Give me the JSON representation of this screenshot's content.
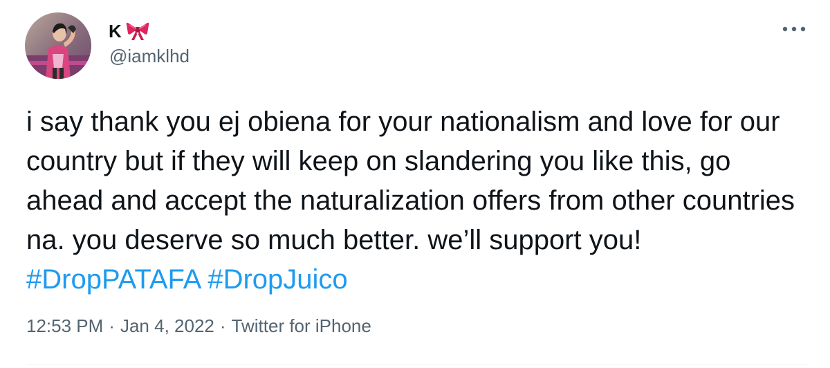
{
  "author": {
    "display_name": "K",
    "handle": "@iamklhd",
    "badge_icon": "bow-icon"
  },
  "tweet": {
    "text_before_tags": "i say thank you ej obiena for your nationalism and love for our country but if they will keep on slandering you like this, go ahead and accept the naturalization offers from other countries na. you deserve so much better. we’ll support you! ",
    "hashtags": [
      "#DropPATAFA",
      "#DropJuico"
    ],
    "time": "12:53 PM",
    "separator": "·",
    "date": "Jan 4, 2022",
    "source": "Twitter for iPhone"
  },
  "colors": {
    "link": "#1d9bf0",
    "secondary_text": "#536471",
    "primary_text": "#0f1419",
    "divider": "#eff3f4"
  }
}
